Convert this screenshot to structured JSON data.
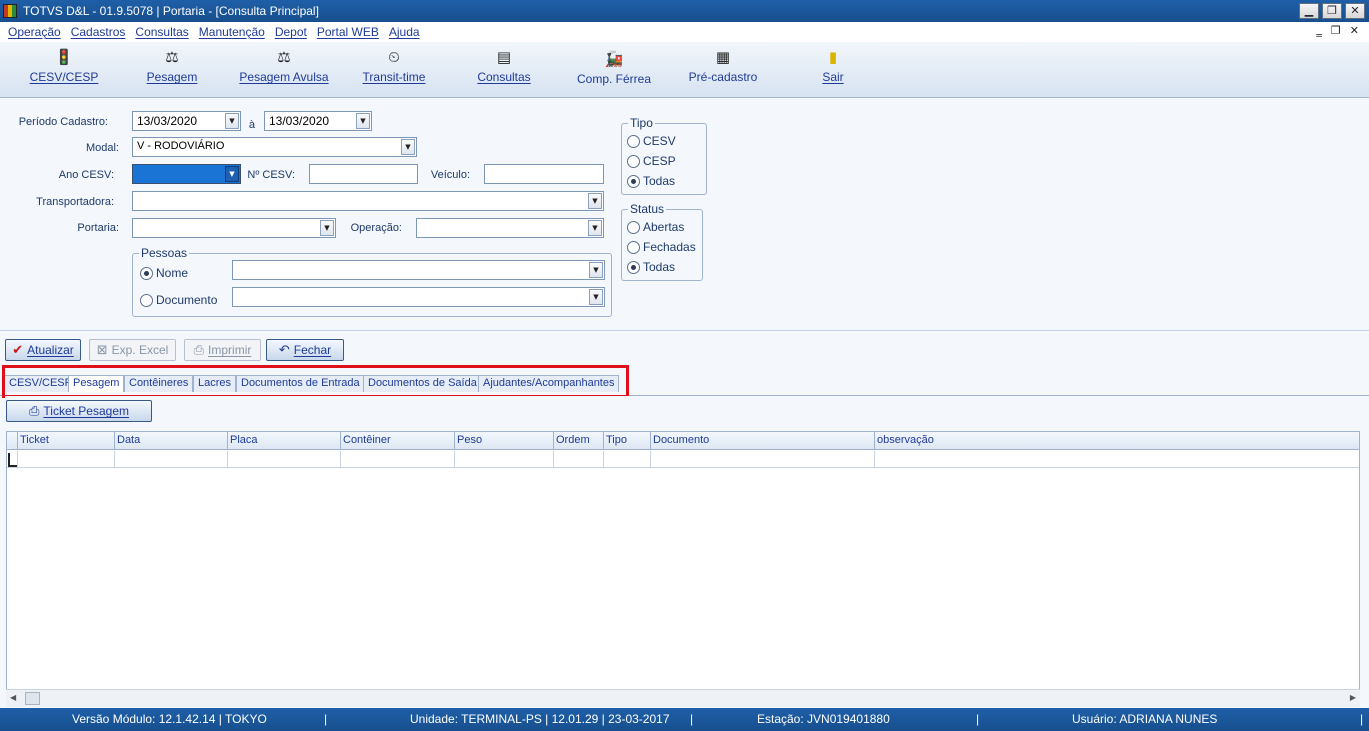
{
  "window": {
    "title": "TOTVS D&L - 01.9.5078 | Portaria - [Consulta Principal]",
    "controls": [
      "▁",
      "❐",
      "✕"
    ],
    "mdi_controls": [
      "‗",
      "❐",
      "✕"
    ]
  },
  "menu": [
    "Operação",
    "Cadastros",
    "Consultas",
    "Manutenção",
    "Depot",
    "Portal WEB",
    "Ajuda"
  ],
  "toolbar": [
    {
      "label": "CESV/CESP",
      "icon": "traffic-light-icon",
      "glyph": "🚦"
    },
    {
      "label": "Pesagem",
      "icon": "scale-icon",
      "glyph": "⚖"
    },
    {
      "label": "Pesagem Avulsa",
      "icon": "scale-icon",
      "glyph": "⚖"
    },
    {
      "label": "Transit-time",
      "icon": "clock-icon",
      "glyph": "⏲"
    },
    {
      "label": "Consultas",
      "icon": "search-document-icon",
      "glyph": "▤"
    },
    {
      "label": "Comp. Férrea",
      "icon": "train-icon",
      "glyph": "🚂"
    },
    {
      "label": "Pré-cadastro",
      "icon": "form-icon",
      "glyph": "▦"
    },
    {
      "label": "Sair",
      "icon": "exit-door-icon",
      "glyph": "▮"
    }
  ],
  "form": {
    "periodo_label": "Período Cadastro:",
    "date_from": "13/03/2020",
    "date_sep": "à",
    "date_to": "13/03/2020",
    "modal_label": "Modal:",
    "modal_value": "V - RODOVIÁRIO",
    "ano_label": "Ano CESV:",
    "ano_value": "",
    "ncesv_label": "Nº CESV:",
    "ncesv_value": "",
    "veiculo_label": "Veículo:",
    "veiculo_value": "",
    "transportadora_label": "Transportadora:",
    "transportadora_value": "",
    "portaria_label": "Portaria:",
    "portaria_value": "",
    "operacao_label": "Operação:",
    "operacao_value": "",
    "pessoas_title": "Pessoas",
    "pessoas_nome": "Nome",
    "pessoas_documento": "Documento",
    "tipo_title": "Tipo",
    "tipo_options": [
      "CESV",
      "CESP",
      "Todas"
    ],
    "status_title": "Status",
    "status_options": [
      "Abertas",
      "Fechadas",
      "Todas"
    ]
  },
  "actions": {
    "atualizar": "Atualizar",
    "exp_excel": "Exp. Excel",
    "imprimir": "Imprimir",
    "fechar": "Fechar"
  },
  "tabs": [
    "CESV/CESP",
    "Pesagem",
    "Contêineres",
    "Lacres",
    "Documentos de Entrada",
    "Documentos de Saída",
    "Ajudantes/Acompanhantes"
  ],
  "active_tab": "Pesagem",
  "ticket_button": "Ticket Pesagem",
  "grid_columns": [
    "Ticket",
    "Data",
    "Placa",
    "Contêiner",
    "Peso",
    "Ordem",
    "Tipo",
    "Documento",
    "observação"
  ],
  "status": {
    "versao": "Versão Módulo:  12.1.42.14  |  TOKYO",
    "unidade": "Unidade: TERMINAL-PS | 12.01.29 | 23-03-2017",
    "estacao": "Estação: JVN019401880",
    "usuario": "Usuário: ADRIANA NUNES"
  },
  "colors": {
    "title_bar": "#1f5fa8",
    "highlight": "#e0101a",
    "selected_field": "#1a74d6"
  }
}
